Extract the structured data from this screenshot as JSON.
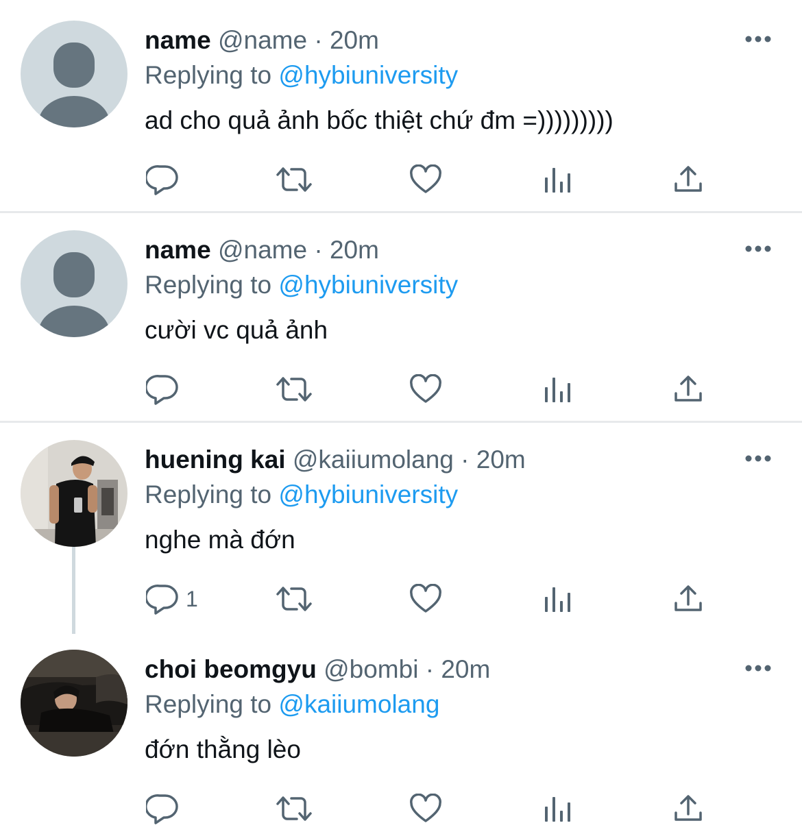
{
  "tweets": [
    {
      "name": "name",
      "handle": "@name",
      "separator": "·",
      "time": "20m",
      "replying_prefix": "Replying to",
      "replying_to": "@hybiuniversity",
      "text": "ad cho quả ảnh bốc thiệt chứ đm =)))))))))",
      "reply_count": ""
    },
    {
      "name": "name",
      "handle": "@name",
      "separator": "·",
      "time": "20m",
      "replying_prefix": "Replying to",
      "replying_to": "@hybiuniversity",
      "text": "cười vc quả ảnh",
      "reply_count": ""
    },
    {
      "name": "huening kai",
      "handle": "@kaiiumolang",
      "separator": "·",
      "time": "20m",
      "replying_prefix": "Replying to",
      "replying_to": "@hybiuniversity",
      "text": "nghe mà đớn",
      "reply_count": "1"
    },
    {
      "name": "choi beomgyu",
      "handle": "@bombi",
      "separator": "·",
      "time": "20m",
      "replying_prefix": "Replying to",
      "replying_to": "@kaiiumolang",
      "text": "đớn thằng lèo",
      "reply_count": ""
    }
  ],
  "icons": {
    "reply": "reply-icon",
    "retweet": "retweet-icon",
    "like": "heart-icon",
    "analytics": "analytics-icon",
    "share": "share-icon",
    "more": "more-icon"
  },
  "colors": {
    "text": "#0f1419",
    "secondary": "#536471",
    "link": "#1d9bf0",
    "divider": "#e7e9eb",
    "avatar_placeholder": "#cfd9de"
  }
}
